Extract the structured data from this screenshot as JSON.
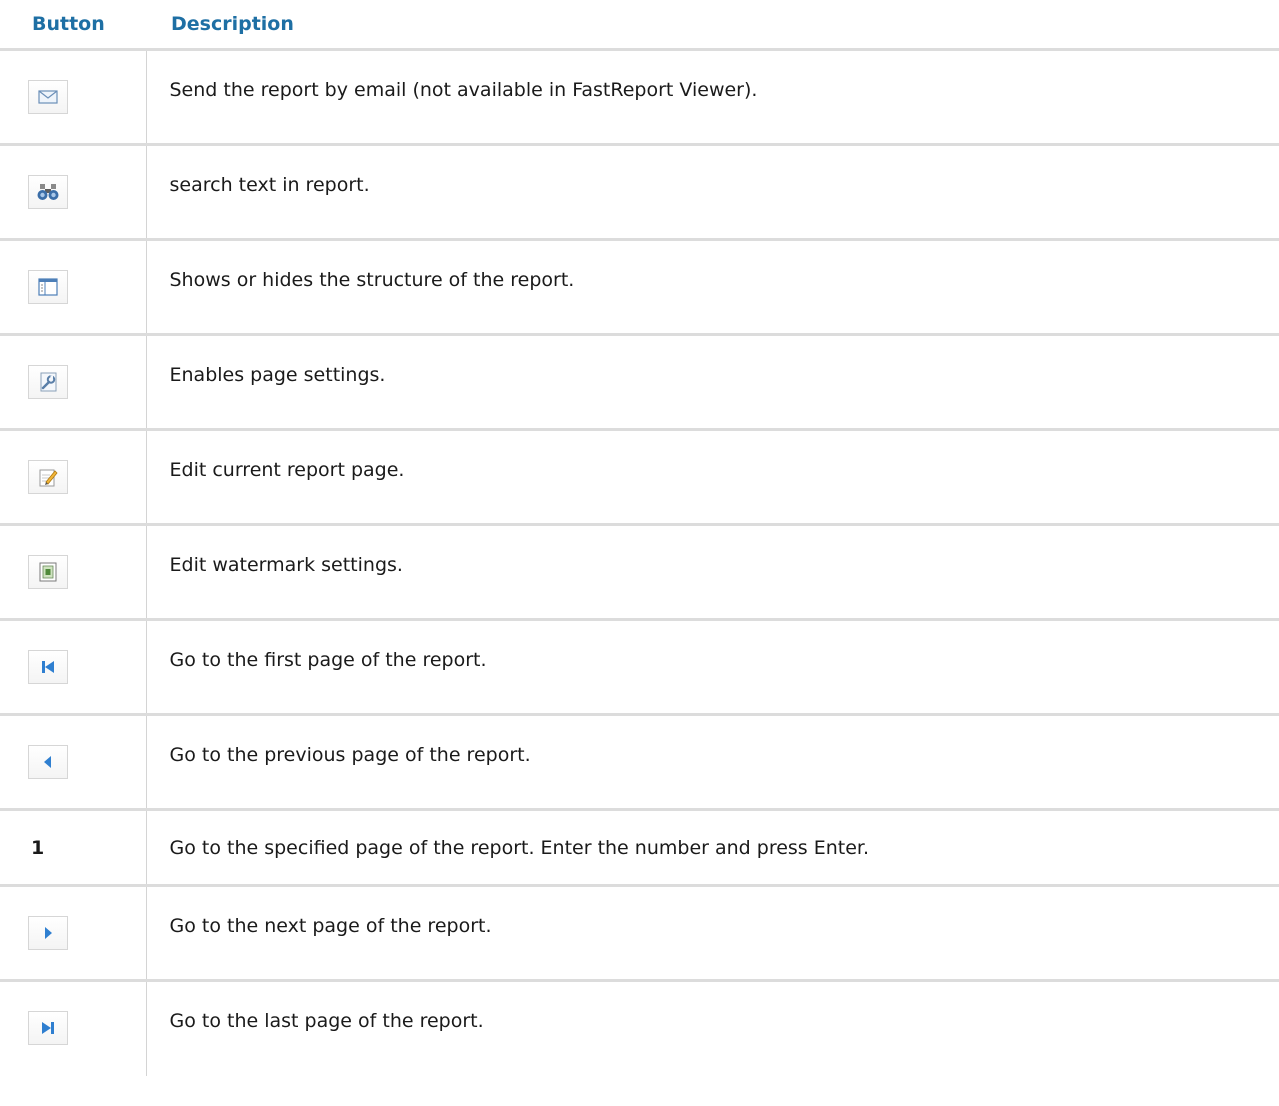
{
  "table": {
    "headers": [
      "Button",
      "Description"
    ],
    "rows": [
      {
        "icon": "email-icon",
        "button_text": "",
        "description": "Send the report by email (not available in FastReport Viewer)."
      },
      {
        "icon": "binoculars-icon",
        "button_text": "",
        "description": "search text in report."
      },
      {
        "icon": "outline-panel-icon",
        "button_text": "",
        "description": "Shows or hides the structure of the report."
      },
      {
        "icon": "page-settings-icon",
        "button_text": "",
        "description": "Enables page settings."
      },
      {
        "icon": "edit-page-icon",
        "button_text": "",
        "description": "Edit current report page."
      },
      {
        "icon": "watermark-icon",
        "button_text": "",
        "description": "Edit watermark settings."
      },
      {
        "icon": "first-page-icon",
        "button_text": "",
        "description": "Go to the first page of the report."
      },
      {
        "icon": "previous-page-icon",
        "button_text": "",
        "description": "Go to the previous page of the report."
      },
      {
        "icon": "",
        "button_text": "1",
        "description": "Go to the specified page of the report. Enter the number and press Enter."
      },
      {
        "icon": "next-page-icon",
        "button_text": "",
        "description": "Go to the next page of the report."
      },
      {
        "icon": "last-page-icon",
        "button_text": "",
        "description": "Go to the last page of the report."
      }
    ]
  },
  "colors": {
    "header_text": "#1e6fa4",
    "row_border": "#dcdcdc",
    "nav_icon_blue": "#2f7fd0"
  }
}
